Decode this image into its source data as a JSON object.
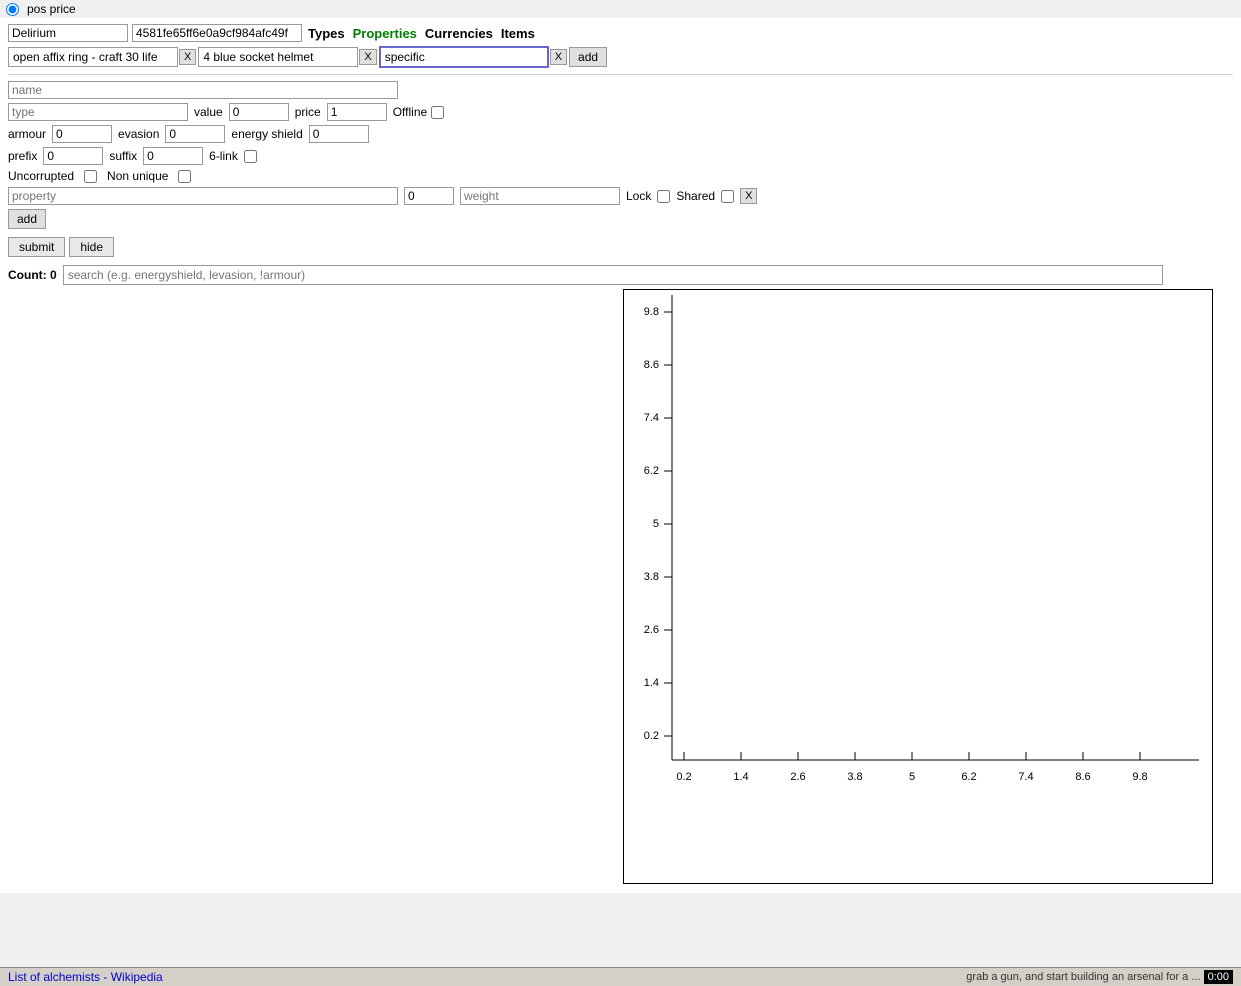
{
  "radio": {
    "pos_price_label": "pos price"
  },
  "league_row": {
    "league_value": "Delirium",
    "hash_value": "4581fe65ff6e0a9cf984afc49f",
    "tabs": [
      {
        "label": "Types",
        "color": "#000000"
      },
      {
        "label": "Properties",
        "color": "#008000"
      },
      {
        "label": "Currencies",
        "color": "#000000"
      },
      {
        "label": "Items",
        "color": "#000000"
      }
    ]
  },
  "filter_row": {
    "filter1_value": "open affix ring - craft 30 life",
    "filter2_value": "4 blue socket helmet",
    "filter3_value": "spеcific",
    "add_label": "add"
  },
  "form": {
    "name_placeholder": "name",
    "type_placeholder": "type",
    "value_label": "value",
    "value_value": "0",
    "price_label": "price",
    "price_value": "1",
    "offline_label": "Offline",
    "armour_label": "armour",
    "armour_value": "0",
    "evasion_label": "evasion",
    "evasion_value": "0",
    "energy_shield_label": "energy shield",
    "energy_shield_value": "0",
    "prefix_label": "prefix",
    "prefix_value": "0",
    "suffix_label": "suffix",
    "suffix_value": "0",
    "six_link_label": "6-link",
    "uncorrupted_label": "Uncorrupted",
    "non_unique_label": "Non unique",
    "property_placeholder": "property",
    "prop_value": "0",
    "weight_placeholder": "weight",
    "lock_label": "Lock",
    "shared_label": "Shared",
    "x_label": "X",
    "add_property_label": "add",
    "submit_label": "submit",
    "hide_label": "hide"
  },
  "results": {
    "count_label": "Count:",
    "count_value": "0",
    "search_placeholder": "search (e.g. energyshield, levasion, !armour)"
  },
  "chart": {
    "y_labels": [
      "9.8",
      "8.6",
      "7.4",
      "6.2",
      "5",
      "3.8",
      "2.6",
      "1.4",
      "0.2"
    ],
    "x_labels": [
      "0.2",
      "1.4",
      "2.6",
      "3.8",
      "5",
      "6.2",
      "7.4",
      "8.6",
      "9.8"
    ]
  },
  "bottom": {
    "link_text": "List of alchemists - Wikipedia",
    "right_text": "grab a gun, and start building an arsenal for a ...",
    "time": "0:00"
  }
}
